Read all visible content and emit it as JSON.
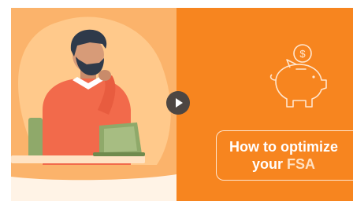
{
  "video": {
    "title_line1": "How to optimize",
    "title_line2_a": "your",
    "title_line2_b": "FSA",
    "play_icon": "play-icon",
    "piggy_icon": "piggy-bank-icon",
    "coin_icon": "dollar-coin-icon",
    "colors": {
      "left_bg": "#fbb36b",
      "right_bg": "#f7851f",
      "play_button": "#4d4642"
    }
  }
}
